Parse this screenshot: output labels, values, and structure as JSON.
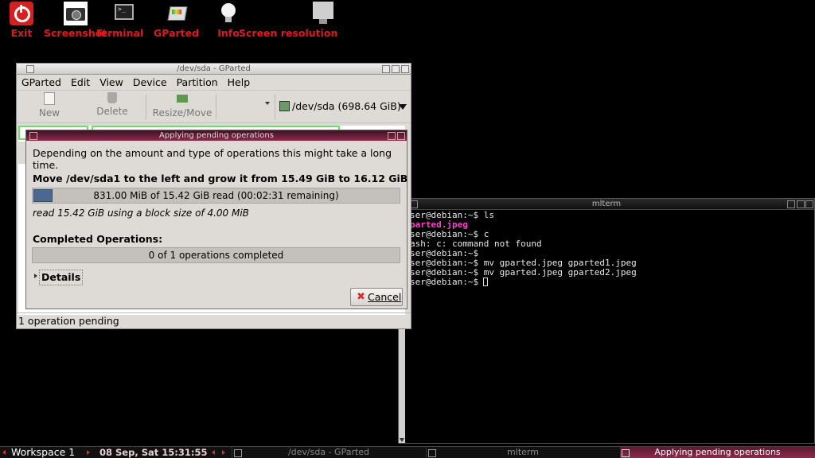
{
  "desktop_icons": [
    {
      "label": "Exit"
    },
    {
      "label": "Screenshot"
    },
    {
      "label": "Terminal"
    },
    {
      "label": "GParted"
    },
    {
      "label": "Info"
    },
    {
      "label": "Screen resolution"
    }
  ],
  "gparted": {
    "title": "/dev/sda - GParted",
    "menu": [
      "GParted",
      "Edit",
      "View",
      "Device",
      "Partition",
      "Help"
    ],
    "toolbar": {
      "new": "New",
      "delete": "Delete",
      "resize": "Resize/Move"
    },
    "device": "/dev/sda  (698.64 GiB)",
    "status": "1 operation pending"
  },
  "dialog": {
    "title": "Applying pending operations",
    "intro": "Depending on the amount and type of operations this might take a long time.",
    "operation": "Move /dev/sda1 to the left and grow it from 15.49 GiB to 16.12 GiB",
    "progress_text": "831.00 MiB of 15.42 GiB read (00:02:31 remaining)",
    "progress_fraction": 0.053,
    "read_info": "read 15.42 GiB using a block size of 4.00 MiB",
    "completed_heading": "Completed Operations:",
    "completed_text": "0 of 1 operations completed",
    "details_label": "Details",
    "cancel_label": "Cancel"
  },
  "terminal": {
    "title": "mlterm",
    "lines": [
      "ser@debian:~$ ls",
      "parted.jpeg",
      "ser@debian:~$ c",
      "ash: c: command not found",
      "ser@debian:~$",
      "ser@debian:~$ mv gparted.jpeg gparted1.jpeg",
      "ser@debian:~$ mv gparted.jpeg gparted2.jpeg",
      "ser@debian:~$ "
    ]
  },
  "taskbar": {
    "workspace": "Workspace 1",
    "clock": "08 Sep, Sat 15:31:55",
    "tasks": [
      "/dev/sda - GParted",
      "mlterm",
      "Applying pending operations"
    ]
  },
  "colors": {
    "icon_label": "#e01818",
    "dialog_title": "#8e2a4c",
    "highlight_file": "#ff3fd0"
  }
}
